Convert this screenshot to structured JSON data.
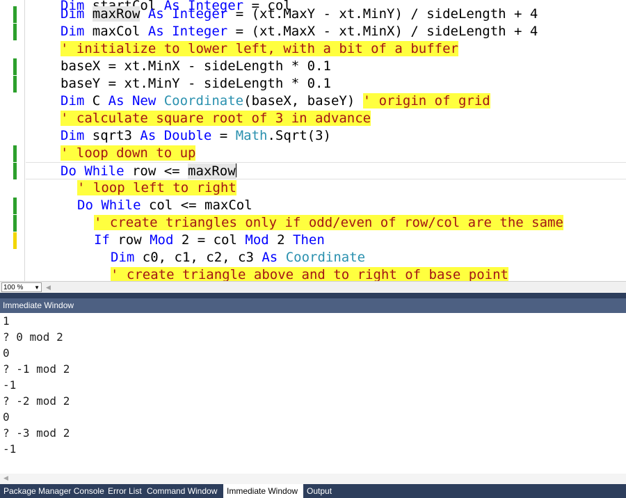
{
  "editor": {
    "lines": [
      {
        "parts": [
          [
            "kw",
            "Dim "
          ],
          [
            "",
            "startCol "
          ],
          [
            "kw",
            "As Integer "
          ],
          [
            "",
            "= col"
          ]
        ]
      },
      {
        "parts": [
          [
            "kw",
            "Dim "
          ],
          [
            "ref",
            "maxRow"
          ],
          [
            "",
            ""
          ],
          [
            "kw",
            " As Integer"
          ],
          [
            "",
            " = (xt.MaxY - xt.MinY) / sideLength + 4"
          ]
        ]
      },
      {
        "parts": [
          [
            "kw",
            "Dim "
          ],
          [
            "",
            "maxCol "
          ],
          [
            "kw",
            "As Integer"
          ],
          [
            "",
            " = (xt.MaxX - xt.MinX) / sideLength + 4"
          ]
        ]
      },
      {
        "parts": [
          [
            "hl",
            "' initialize to lower left, with a bit of a buffer"
          ]
        ]
      },
      {
        "parts": [
          [
            "",
            "baseX = xt.MinX - sideLength * 0.1"
          ]
        ]
      },
      {
        "parts": [
          [
            "",
            "baseY = xt.MinY - sideLength * 0.1"
          ]
        ]
      },
      {
        "parts": [
          [
            "kw",
            "Dim "
          ],
          [
            "",
            "C "
          ],
          [
            "kw",
            "As New "
          ],
          [
            "ty",
            "Coordinate"
          ],
          [
            "",
            "(baseX, baseY) "
          ],
          [
            "hl",
            "' origin of grid"
          ]
        ]
      },
      {
        "parts": [
          [
            "hl",
            "' calculate square root of 3 in advance"
          ]
        ]
      },
      {
        "parts": [
          [
            "kw",
            "Dim "
          ],
          [
            "",
            "sqrt3 "
          ],
          [
            "kw",
            "As Double"
          ],
          [
            "",
            " = "
          ],
          [
            "ty",
            "Math"
          ],
          [
            "",
            ".Sqrt(3)"
          ]
        ]
      },
      {
        "parts": [
          [
            "hl",
            "' loop down to up"
          ]
        ]
      },
      {
        "parts": [
          [
            "kw",
            "Do While "
          ],
          [
            "",
            "row <= "
          ],
          [
            "ref",
            "maxRow"
          ]
        ]
      },
      {
        "parts": [
          [
            "hl",
            "' loop left to right"
          ]
        ]
      },
      {
        "parts": [
          [
            "kw",
            "Do While "
          ],
          [
            "",
            "col <= maxCol"
          ]
        ]
      },
      {
        "parts": [
          [
            "hl",
            "' create triangles only if odd/even of row/col are the same"
          ]
        ]
      },
      {
        "parts": [
          [
            "kw",
            "If "
          ],
          [
            "",
            "row "
          ],
          [
            "kw",
            "Mod "
          ],
          [
            "",
            "2 = col "
          ],
          [
            "kw",
            "Mod "
          ],
          [
            "",
            "2 "
          ],
          [
            "kw",
            "Then"
          ]
        ]
      },
      {
        "parts": [
          [
            "kw",
            "Dim "
          ],
          [
            "",
            "c0, c1, c2, c3 "
          ],
          [
            "kw",
            "As "
          ],
          [
            "ty",
            "Coordinate"
          ]
        ]
      },
      {
        "parts": [
          [
            "hl",
            "' create triangle above and to right of base point"
          ]
        ]
      }
    ]
  },
  "zoom": {
    "value": "100 %"
  },
  "immediate": {
    "title": "Immediate Window",
    "lines": [
      "1",
      "? 0 mod 2",
      "0",
      "? -1 mod 2",
      "-1",
      "? -2 mod 2",
      "0",
      "? -3 mod 2",
      "-1"
    ]
  },
  "tabs": [
    {
      "label": "Package Manager Console",
      "active": false
    },
    {
      "label": "Error List",
      "active": false
    },
    {
      "label": "Command Window",
      "active": false
    },
    {
      "label": "Immediate Window",
      "active": true
    },
    {
      "label": "Output",
      "active": false
    }
  ]
}
